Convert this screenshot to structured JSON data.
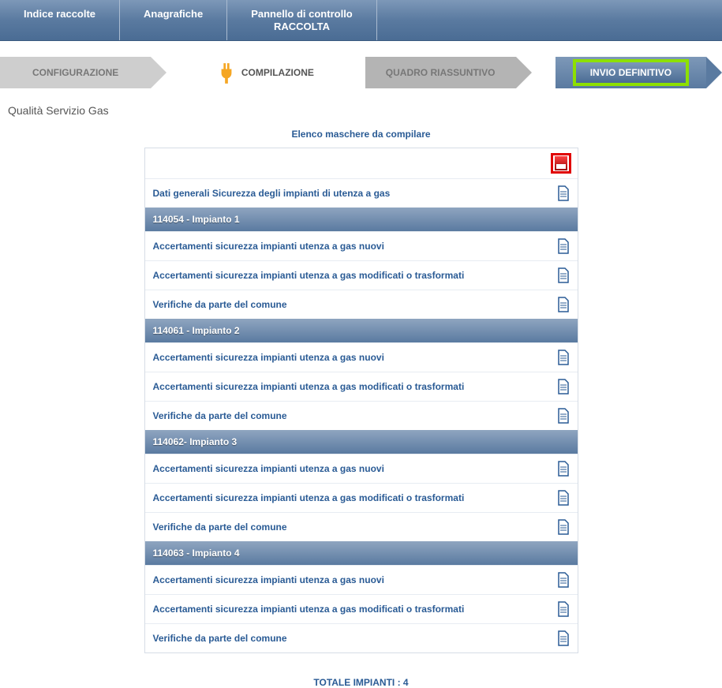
{
  "topnav": {
    "indice": "Indice raccolte",
    "anagrafiche": "Anagrafiche",
    "pannello_l1": "Pannello di controllo",
    "pannello_l2": "RACCOLTA"
  },
  "steps": {
    "configurazione": "CONFIGURAZIONE",
    "compilazione": "COMPILAZIONE",
    "quadro": "QUADRO RIASSUNTIVO",
    "invio": "INVIO DEFINITIVO"
  },
  "page_title": "Qualità Servizio Gas",
  "list_header": "Elenco maschere da compilare",
  "rows": {
    "dati_generali": "Dati generali Sicurezza degli impianti di utenza a gas",
    "acc_nuovi": "Accertamenti sicurezza impianti utenza a gas nuovi",
    "acc_mod": "Accertamenti sicurezza impianti utenza a gas modificati o trasformati",
    "verifiche": "Verifiche da parte del comune"
  },
  "groups": {
    "g1": "114054 - Impianto 1",
    "g2": "114061 - Impianto 2",
    "g3": "114062- Impianto 3",
    "g4": "114063 - Impianto 4"
  },
  "footer": "TOTALE IMPIANTI : 4"
}
